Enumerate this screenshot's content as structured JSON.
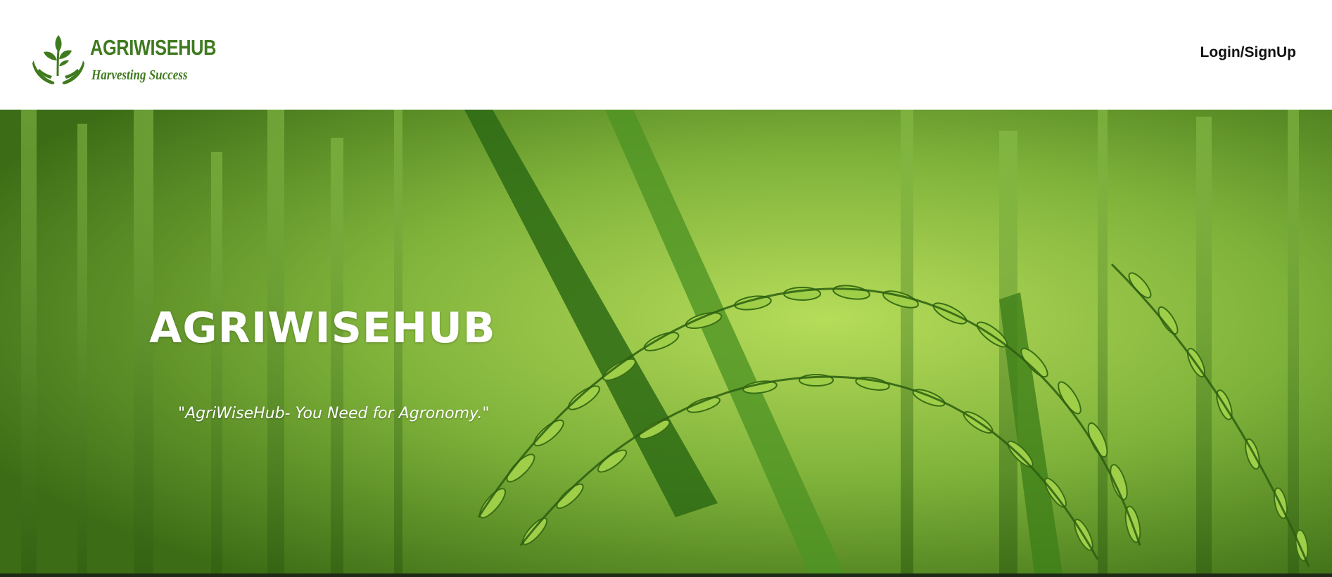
{
  "header": {
    "logo": {
      "name": "AGRIWISEHUB",
      "tagline": "Harvesting Success",
      "icon": "sprout-in-hands-icon"
    },
    "login_label": "Login/SignUp"
  },
  "hero": {
    "title": "AGRIWISEHUB",
    "quote": "\"AgriWiseHub- You Need for Agronomy.\"",
    "background": "rice-field-photo"
  },
  "colors": {
    "brand_green": "#3f7a1f",
    "hero_text": "#ffffff",
    "login_text": "#111111"
  }
}
